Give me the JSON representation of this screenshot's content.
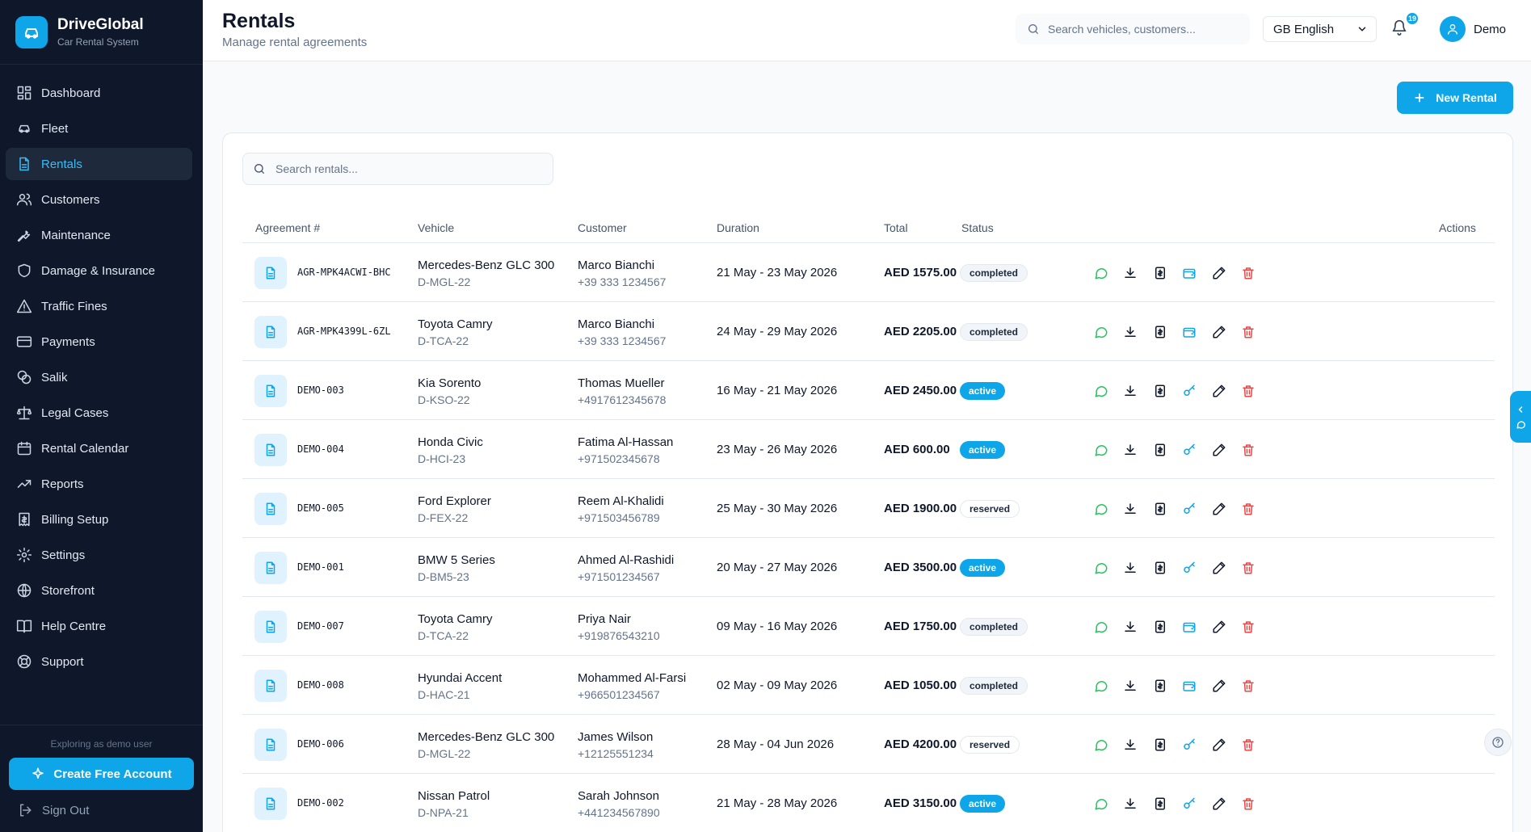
{
  "brand": {
    "name": "DriveGlobal",
    "subtitle": "Car Rental System",
    "icon": "car-icon"
  },
  "sidebar": {
    "items": [
      {
        "label": "Dashboard",
        "icon": "dashboard-icon"
      },
      {
        "label": "Fleet",
        "icon": "car-icon"
      },
      {
        "label": "Rentals",
        "icon": "document-icon",
        "active": true
      },
      {
        "label": "Customers",
        "icon": "users-icon"
      },
      {
        "label": "Maintenance",
        "icon": "wrench-icon"
      },
      {
        "label": "Damage & Insurance",
        "icon": "shield-icon"
      },
      {
        "label": "Traffic Fines",
        "icon": "warning-icon"
      },
      {
        "label": "Payments",
        "icon": "credit-card-icon"
      },
      {
        "label": "Salik",
        "icon": "toll-icon"
      },
      {
        "label": "Legal Cases",
        "icon": "scale-icon"
      },
      {
        "label": "Rental Calendar",
        "icon": "calendar-icon"
      },
      {
        "label": "Reports",
        "icon": "trend-icon"
      },
      {
        "label": "Billing Setup",
        "icon": "receipt-icon"
      },
      {
        "label": "Settings",
        "icon": "gear-icon"
      },
      {
        "label": "Storefront",
        "icon": "globe-icon"
      },
      {
        "label": "Help Centre",
        "icon": "book-icon"
      },
      {
        "label": "Support",
        "icon": "lifebuoy-icon"
      }
    ],
    "demo_note": "Exploring as demo user",
    "create_account": "Create Free Account",
    "sign_out": "Sign Out"
  },
  "header": {
    "title": "Rentals",
    "subtitle": "Manage rental agreements",
    "search_placeholder": "Search vehicles, customers...",
    "language": "GB English",
    "notification_count": "19",
    "user_name": "Demo"
  },
  "main": {
    "new_rental_label": "New Rental",
    "search_placeholder": "Search rentals...",
    "columns": [
      "Agreement #",
      "Vehicle",
      "Customer",
      "Duration",
      "Total",
      "Status",
      "Actions"
    ],
    "rows": [
      {
        "agreement": "AGR-MPK4ACWI-BHC",
        "vehicle": "Mercedes-Benz GLC 300",
        "plate": "D-MGL-22",
        "customer": "Marco Bianchi",
        "phone": "+39 333 1234567",
        "duration": "21 May - 23 May 2026",
        "total": "AED 1575.00",
        "status": "completed"
      },
      {
        "agreement": "AGR-MPK4399L-6ZL",
        "vehicle": "Toyota Camry",
        "plate": "D-TCA-22",
        "customer": "Marco Bianchi",
        "phone": "+39 333 1234567",
        "duration": "24 May - 29 May 2026",
        "total": "AED 2205.00",
        "status": "completed"
      },
      {
        "agreement": "DEMO-003",
        "vehicle": "Kia Sorento",
        "plate": "D-KSO-22",
        "customer": "Thomas Mueller",
        "phone": "+4917612345678",
        "duration": "16 May - 21 May 2026",
        "total": "AED 2450.00",
        "status": "active"
      },
      {
        "agreement": "DEMO-004",
        "vehicle": "Honda Civic",
        "plate": "D-HCI-23",
        "customer": "Fatima Al-Hassan",
        "phone": "+971502345678",
        "duration": "23 May - 26 May 2026",
        "total": "AED 600.00",
        "status": "active"
      },
      {
        "agreement": "DEMO-005",
        "vehicle": "Ford Explorer",
        "plate": "D-FEX-22",
        "customer": "Reem Al-Khalidi",
        "phone": "+971503456789",
        "duration": "25 May - 30 May 2026",
        "total": "AED 1900.00",
        "status": "reserved"
      },
      {
        "agreement": "DEMO-001",
        "vehicle": "BMW 5 Series",
        "plate": "D-BM5-23",
        "customer": "Ahmed Al-Rashidi",
        "phone": "+971501234567",
        "duration": "20 May - 27 May 2026",
        "total": "AED 3500.00",
        "status": "active"
      },
      {
        "agreement": "DEMO-007",
        "vehicle": "Toyota Camry",
        "plate": "D-TCA-22",
        "customer": "Priya Nair",
        "phone": "+919876543210",
        "duration": "09 May - 16 May 2026",
        "total": "AED 1750.00",
        "status": "completed"
      },
      {
        "agreement": "DEMO-008",
        "vehicle": "Hyundai Accent",
        "plate": "D-HAC-21",
        "customer": "Mohammed Al-Farsi",
        "phone": "+966501234567",
        "duration": "02 May - 09 May 2026",
        "total": "AED 1050.00",
        "status": "completed"
      },
      {
        "agreement": "DEMO-006",
        "vehicle": "Mercedes-Benz GLC 300",
        "plate": "D-MGL-22",
        "customer": "James Wilson",
        "phone": "+12125551234",
        "duration": "28 May - 04 Jun 2026",
        "total": "AED 4200.00",
        "status": "reserved"
      },
      {
        "agreement": "DEMO-002",
        "vehicle": "Nissan Patrol",
        "plate": "D-NPA-21",
        "customer": "Sarah Johnson",
        "phone": "+441234567890",
        "duration": "21 May - 28 May 2026",
        "total": "AED 3150.00",
        "status": "active"
      }
    ]
  },
  "colors": {
    "accent": "#0ea5e9",
    "sidebar_bg": "#0f172a",
    "whatsapp_green": "#22c55e",
    "delete_red": "#ef4444"
  }
}
